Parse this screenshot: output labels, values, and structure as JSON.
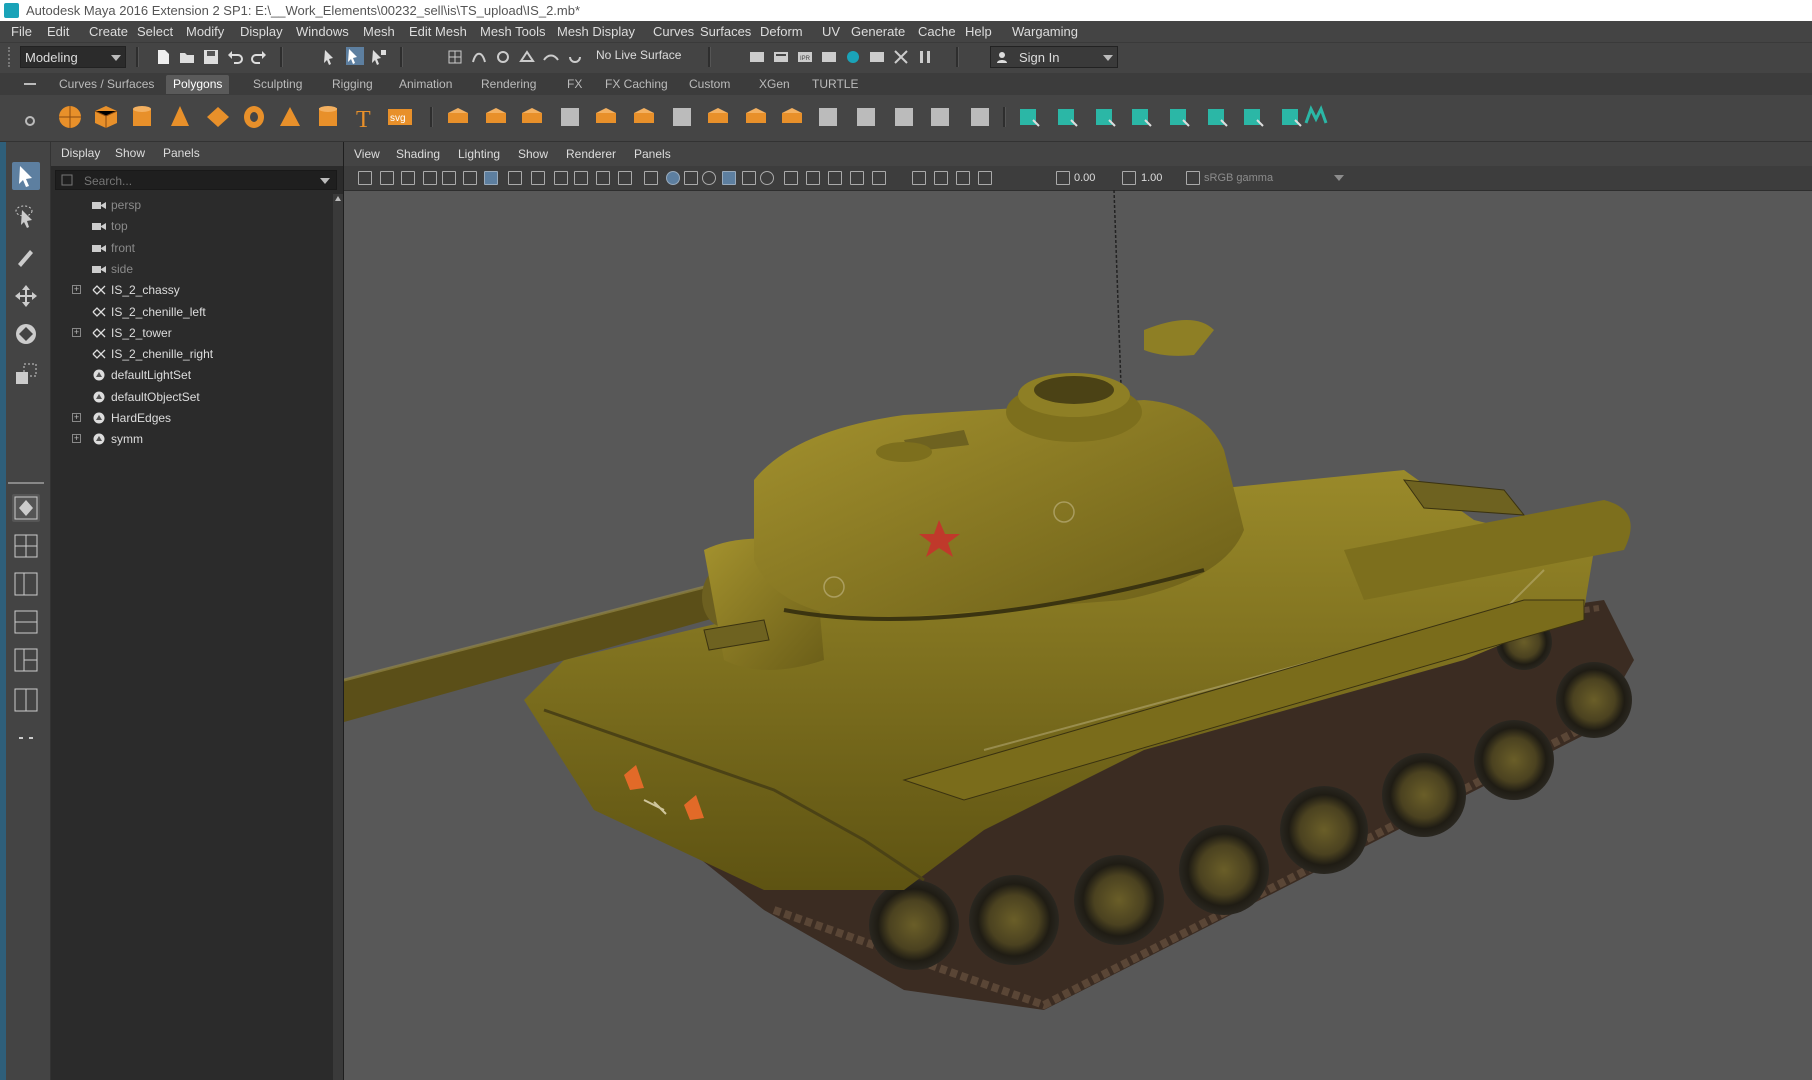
{
  "titlebar": {
    "title": "Autodesk Maya 2016 Extension 2 SP1: E:\\__Work_Elements\\00232_sell\\is\\TS_upload\\IS_2.mb*"
  },
  "menu": [
    "File",
    "Edit",
    "Create",
    "Select",
    "Modify",
    "Display",
    "Windows",
    "Mesh",
    "Edit Mesh",
    "Mesh Tools",
    "Mesh Display",
    "Curves",
    "Surfaces",
    "Deform",
    "UV",
    "Generate",
    "Cache",
    "Help",
    "Wargaming"
  ],
  "statusline": {
    "mode": "Modeling",
    "live_surface": "No Live Surface",
    "sign_in": "Sign In"
  },
  "shelf_tabs": [
    "Curves / Surfaces",
    "Polygons",
    "Sculpting",
    "Rigging",
    "Animation",
    "Rendering",
    "FX",
    "FX Caching",
    "Custom",
    "XGen",
    "TURTLE"
  ],
  "shelf_active": "Polygons",
  "shelf_icons": [
    "poly-sphere-icon",
    "poly-cube-icon",
    "poly-cylinder-icon",
    "poly-cone-icon",
    "poly-plane-icon",
    "poly-torus-icon",
    "poly-prism-icon",
    "poly-pipe-icon",
    "type-tool-icon",
    "svg-tool-icon",
    "combine-icon",
    "separate-icon",
    "mirror-icon",
    "smooth-icon",
    "extract-icon",
    "booleans-icon",
    "multi-cut-icon",
    "bevel-icon",
    "bridge-icon",
    "extrude-icon",
    "append-icon",
    "fill-hole-icon",
    "insert-edge-loop-icon",
    "merge-icon",
    "target-weld-icon",
    "make-live-icon",
    "uv-planar-icon",
    "uv-cylindrical-icon",
    "uv-spherical-icon",
    "uv-auto-icon",
    "uv-unfold-icon",
    "uv-layout-icon",
    "uv-editor-icon",
    "maya-logo-icon"
  ],
  "shelf_svg_label": "svg",
  "shelf_type_label": "T",
  "outliner": {
    "menu": [
      "Display",
      "Show",
      "Panels"
    ],
    "search_placeholder": "Search...",
    "items": [
      {
        "label": "persp",
        "type": "camera",
        "expandable": false,
        "dim": true
      },
      {
        "label": "top",
        "type": "camera",
        "expandable": false,
        "dim": true
      },
      {
        "label": "front",
        "type": "camera",
        "expandable": false,
        "dim": true
      },
      {
        "label": "side",
        "type": "camera",
        "expandable": false,
        "dim": true
      },
      {
        "label": "IS_2_chassy",
        "type": "mesh",
        "expandable": true,
        "dim": false
      },
      {
        "label": "IS_2_chenille_left",
        "type": "mesh",
        "expandable": false,
        "dim": false
      },
      {
        "label": "IS_2_tower",
        "type": "mesh",
        "expandable": true,
        "dim": false
      },
      {
        "label": "IS_2_chenille_right",
        "type": "mesh",
        "expandable": false,
        "dim": false
      },
      {
        "label": "defaultLightSet",
        "type": "set",
        "expandable": false,
        "dim": false
      },
      {
        "label": "defaultObjectSet",
        "type": "set",
        "expandable": false,
        "dim": false
      },
      {
        "label": "HardEdges",
        "type": "set",
        "expandable": true,
        "dim": false
      },
      {
        "label": "symm",
        "type": "set",
        "expandable": true,
        "dim": false
      }
    ]
  },
  "viewport": {
    "menu": [
      "View",
      "Shading",
      "Lighting",
      "Show",
      "Renderer",
      "Panels"
    ],
    "exposure": "0.00",
    "gamma": "1.00",
    "color_space": "sRGB gamma"
  },
  "colors": {
    "accent": "#5d7fa0",
    "shelf_orange": "#e8902a",
    "shelf_teal": "#2bb7a6",
    "tank_olive": "#8a7a1e",
    "viewport_bg": "#585858"
  }
}
